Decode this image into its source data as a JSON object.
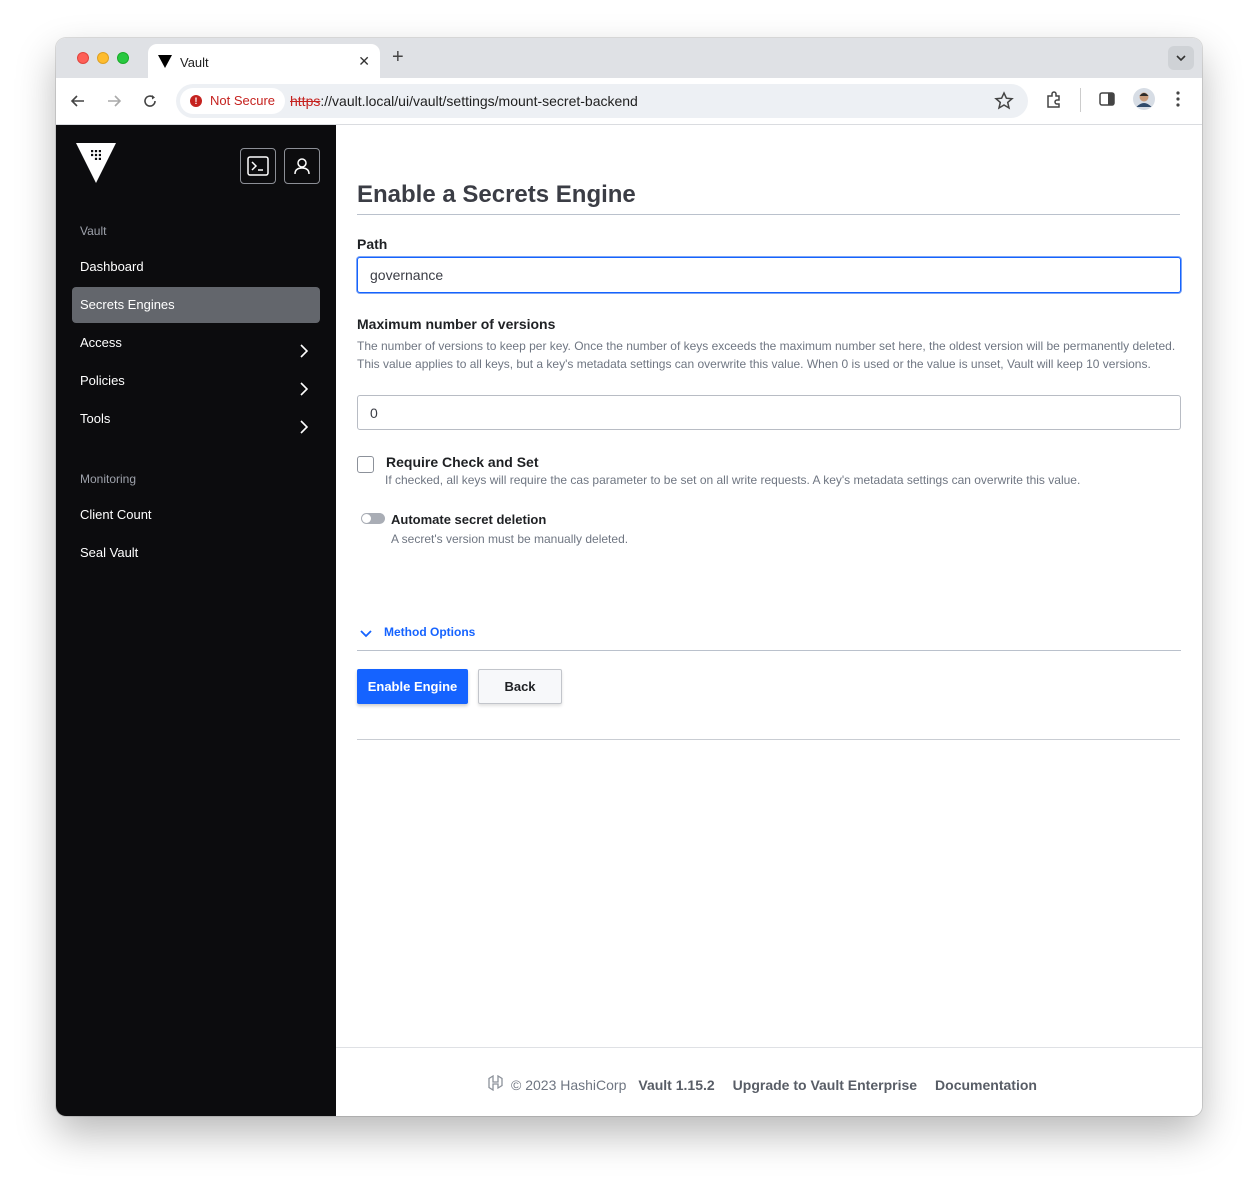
{
  "browser": {
    "tab_title": "Vault",
    "security_label": "Not Secure",
    "url_scheme": "https",
    "url_rest": "://vault.local/ui/vault/settings/mount-secret-backend"
  },
  "sidebar": {
    "section_vault": "Vault",
    "section_monitoring": "Monitoring",
    "items": [
      {
        "label": "Dashboard"
      },
      {
        "label": "Secrets Engines"
      },
      {
        "label": "Access"
      },
      {
        "label": "Policies"
      },
      {
        "label": "Tools"
      },
      {
        "label": "Client Count"
      },
      {
        "label": "Seal Vault"
      }
    ]
  },
  "form": {
    "title": "Enable a Secrets Engine",
    "path_label": "Path",
    "path_value": "governance",
    "max_versions_label": "Maximum number of versions",
    "max_versions_help": "The number of versions to keep per key. Once the number of keys exceeds the maximum number set here, the oldest version will be permanently deleted. This value applies to all keys, but a key's metadata settings can overwrite this value. When 0 is used or the value is unset, Vault will keep 10 versions.",
    "max_versions_value": "0",
    "cas_label": "Require Check and Set",
    "cas_help": "If checked, all keys will require the cas parameter to be set on all write requests. A key's metadata settings can overwrite this value.",
    "delete_label": "Automate secret deletion",
    "delete_help": "A secret's version must be manually deleted.",
    "method_options": "Method Options",
    "enable_button": "Enable Engine",
    "back_button": "Back"
  },
  "footer": {
    "copyright": "© 2023 HashiCorp",
    "version": "Vault 1.15.2",
    "upgrade_link": "Upgrade to Vault Enterprise",
    "docs_link": "Documentation"
  },
  "colors": {
    "accent": "#1563ff",
    "sidebar_bg": "#0c0c0e",
    "active_item": "#63666c"
  }
}
